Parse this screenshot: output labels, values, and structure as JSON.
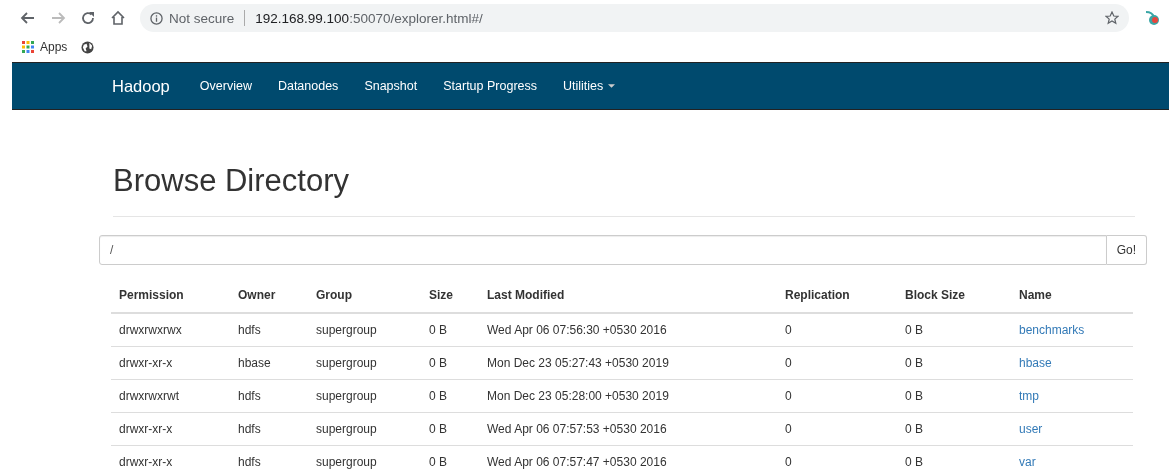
{
  "browser": {
    "security_label": "Not secure",
    "url_host": "192.168.99.100",
    "url_path": ":50070/explorer.html#/",
    "bookmarks": [
      {
        "kind": "apps",
        "label": "Apps"
      },
      {
        "kind": "globe"
      }
    ]
  },
  "navbar": {
    "brand": "Hadoop",
    "items": [
      {
        "label": "Overview",
        "dropdown": false
      },
      {
        "label": "Datanodes",
        "dropdown": false
      },
      {
        "label": "Snapshot",
        "dropdown": false
      },
      {
        "label": "Startup Progress",
        "dropdown": false
      },
      {
        "label": "Utilities",
        "dropdown": true
      }
    ]
  },
  "heading": "Browse Directory",
  "path_field": {
    "value": "/",
    "button": "Go!"
  },
  "table": {
    "columns": [
      "Permission",
      "Owner",
      "Group",
      "Size",
      "Last Modified",
      "Replication",
      "Block Size",
      "Name"
    ],
    "rows": [
      [
        "drwxrwxrwx",
        "hdfs",
        "supergroup",
        "0 B",
        "Wed Apr 06 07:56:30 +0530 2016",
        "0",
        "0 B",
        "benchmarks"
      ],
      [
        "drwxr-xr-x",
        "hbase",
        "supergroup",
        "0 B",
        "Mon Dec 23 05:27:43 +0530 2019",
        "0",
        "0 B",
        "hbase"
      ],
      [
        "drwxrwxrwt",
        "hdfs",
        "supergroup",
        "0 B",
        "Mon Dec 23 05:28:00 +0530 2019",
        "0",
        "0 B",
        "tmp"
      ],
      [
        "drwxr-xr-x",
        "hdfs",
        "supergroup",
        "0 B",
        "Wed Apr 06 07:57:53 +0530 2016",
        "0",
        "0 B",
        "user"
      ],
      [
        "drwxr-xr-x",
        "hdfs",
        "supergroup",
        "0 B",
        "Wed Apr 06 07:57:47 +0530 2016",
        "0",
        "0 B",
        "var"
      ]
    ]
  }
}
